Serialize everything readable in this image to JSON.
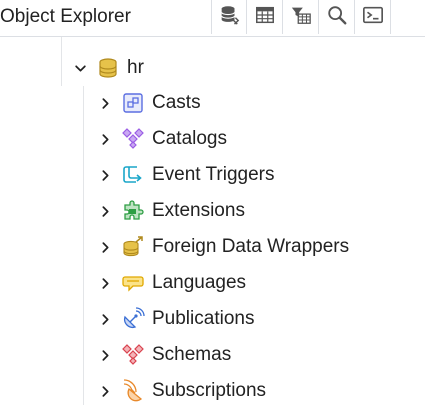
{
  "panel": {
    "title": "Object Explorer",
    "toolbar": [
      {
        "name": "query-tool-icon"
      },
      {
        "name": "view-data-icon"
      },
      {
        "name": "filtered-rows-icon"
      },
      {
        "name": "search-objects-icon"
      },
      {
        "name": "psql-tool-icon"
      }
    ]
  },
  "tree": {
    "database": {
      "label": "hr",
      "icon": "database-icon",
      "expanded": true
    },
    "children": [
      {
        "label": "Casts",
        "icon": "casts-icon"
      },
      {
        "label": "Catalogs",
        "icon": "catalogs-icon"
      },
      {
        "label": "Event Triggers",
        "icon": "event-triggers-icon"
      },
      {
        "label": "Extensions",
        "icon": "extensions-icon"
      },
      {
        "label": "Foreign Data Wrappers",
        "icon": "foreign-data-wrappers-icon"
      },
      {
        "label": "Languages",
        "icon": "languages-icon"
      },
      {
        "label": "Publications",
        "icon": "publications-icon"
      },
      {
        "label": "Schemas",
        "icon": "schemas-icon"
      },
      {
        "label": "Subscriptions",
        "icon": "subscriptions-icon"
      }
    ]
  },
  "colors": {
    "database": "#c9a227",
    "casts": "#5b6ee1",
    "catalogs": "#9b5de5",
    "event_triggers": "#1aa6c9",
    "extensions": "#2e9e44",
    "languages": "#f2c31b",
    "publications": "#3b6fd4",
    "schemas": "#d9434f",
    "subscriptions": "#e8892b"
  }
}
